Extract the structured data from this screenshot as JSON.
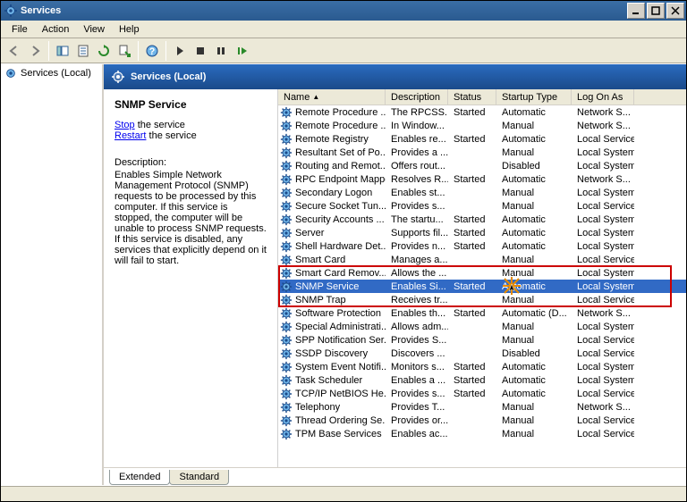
{
  "window": {
    "title": "Services"
  },
  "menu": {
    "file": "File",
    "action": "Action",
    "view": "View",
    "help": "Help"
  },
  "tree": {
    "root": "Services (Local)"
  },
  "header": {
    "title": "Services (Local)"
  },
  "details": {
    "title": "SNMP Service",
    "stop_label": "Stop",
    "stop_rest": " the service",
    "restart_label": "Restart",
    "restart_rest": " the service",
    "desc_label": "Description:",
    "desc_text": "Enables Simple Network Management Protocol (SNMP) requests to be processed by this computer. If this service is stopped, the computer will be unable to process SNMP requests. If this service is disabled, any services that explicitly depend on it will fail to start."
  },
  "columns": {
    "name": "Name",
    "name_sort": "▲",
    "desc": "Description",
    "status": "Status",
    "stype": "Startup Type",
    "logon": "Log On As"
  },
  "rows": [
    {
      "name": "Remote Procedure ...",
      "desc": "The RPCSS...",
      "status": "Started",
      "stype": "Automatic",
      "logon": "Network S..."
    },
    {
      "name": "Remote Procedure ...",
      "desc": "In Window...",
      "status": "",
      "stype": "Manual",
      "logon": "Network S..."
    },
    {
      "name": "Remote Registry",
      "desc": "Enables re...",
      "status": "Started",
      "stype": "Automatic",
      "logon": "Local Service"
    },
    {
      "name": "Resultant Set of Po...",
      "desc": "Provides a ...",
      "status": "",
      "stype": "Manual",
      "logon": "Local System"
    },
    {
      "name": "Routing and Remot...",
      "desc": "Offers rout...",
      "status": "",
      "stype": "Disabled",
      "logon": "Local System"
    },
    {
      "name": "RPC Endpoint Mapper",
      "desc": "Resolves R...",
      "status": "Started",
      "stype": "Automatic",
      "logon": "Network S..."
    },
    {
      "name": "Secondary Logon",
      "desc": "Enables st...",
      "status": "",
      "stype": "Manual",
      "logon": "Local System"
    },
    {
      "name": "Secure Socket Tun...",
      "desc": "Provides s...",
      "status": "",
      "stype": "Manual",
      "logon": "Local Service"
    },
    {
      "name": "Security Accounts ...",
      "desc": "The startu...",
      "status": "Started",
      "stype": "Automatic",
      "logon": "Local System"
    },
    {
      "name": "Server",
      "desc": "Supports fil...",
      "status": "Started",
      "stype": "Automatic",
      "logon": "Local System"
    },
    {
      "name": "Shell Hardware Det...",
      "desc": "Provides n...",
      "status": "Started",
      "stype": "Automatic",
      "logon": "Local System"
    },
    {
      "name": "Smart Card",
      "desc": "Manages a...",
      "status": "",
      "stype": "Manual",
      "logon": "Local Service"
    },
    {
      "name": "Smart Card Remov...",
      "desc": "Allows the ...",
      "status": "",
      "stype": "Manual",
      "logon": "Local System"
    },
    {
      "name": "SNMP Service",
      "desc": "Enables Si...",
      "status": "Started",
      "stype": "Automatic",
      "logon": "Local System",
      "selected": true
    },
    {
      "name": "SNMP Trap",
      "desc": "Receives tr...",
      "status": "",
      "stype": "Manual",
      "logon": "Local Service"
    },
    {
      "name": "Software Protection",
      "desc": "Enables th...",
      "status": "Started",
      "stype": "Automatic (D...",
      "logon": "Network S..."
    },
    {
      "name": "Special Administrati...",
      "desc": "Allows adm...",
      "status": "",
      "stype": "Manual",
      "logon": "Local System"
    },
    {
      "name": "SPP Notification Ser...",
      "desc": "Provides S...",
      "status": "",
      "stype": "Manual",
      "logon": "Local Service"
    },
    {
      "name": "SSDP Discovery",
      "desc": "Discovers ...",
      "status": "",
      "stype": "Disabled",
      "logon": "Local Service"
    },
    {
      "name": "System Event Notifi...",
      "desc": "Monitors s...",
      "status": "Started",
      "stype": "Automatic",
      "logon": "Local System"
    },
    {
      "name": "Task Scheduler",
      "desc": "Enables a ...",
      "status": "Started",
      "stype": "Automatic",
      "logon": "Local System"
    },
    {
      "name": "TCP/IP NetBIOS He...",
      "desc": "Provides s...",
      "status": "Started",
      "stype": "Automatic",
      "logon": "Local Service"
    },
    {
      "name": "Telephony",
      "desc": "Provides T...",
      "status": "",
      "stype": "Manual",
      "logon": "Network S..."
    },
    {
      "name": "Thread Ordering Se...",
      "desc": "Provides or...",
      "status": "",
      "stype": "Manual",
      "logon": "Local Service"
    },
    {
      "name": "TPM Base Services",
      "desc": "Enables ac...",
      "status": "",
      "stype": "Manual",
      "logon": "Local Service"
    }
  ],
  "tabs": {
    "extended": "Extended",
    "standard": "Standard"
  }
}
